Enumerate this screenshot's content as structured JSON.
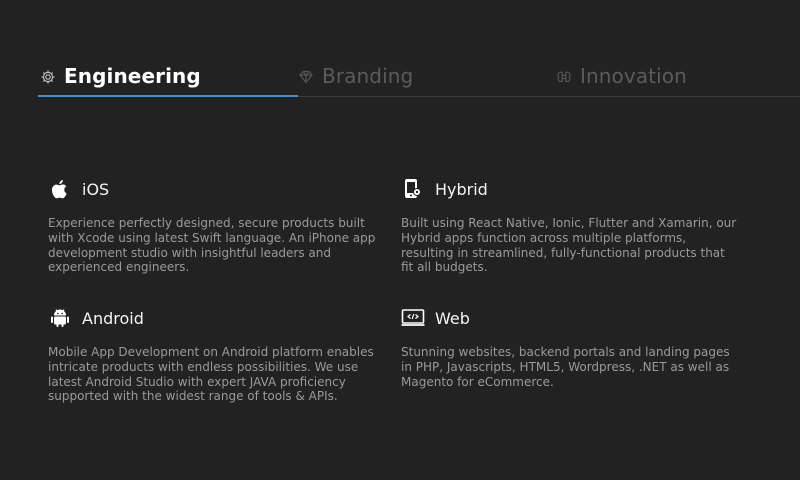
{
  "tabs": [
    {
      "label": "Engineering",
      "icon": "gear-icon",
      "active": true
    },
    {
      "label": "Branding",
      "icon": "diamond-icon",
      "active": false
    },
    {
      "label": "Innovation",
      "icon": "brain-icon",
      "active": false
    }
  ],
  "services": {
    "ios": {
      "title": "iOS",
      "icon": "apple-icon",
      "desc": "Experience perfectly designed, secure products built with Xcode using latest Swift language. An iPhone app development studio with insightful leaders and experienced engineers."
    },
    "hybrid": {
      "title": "Hybrid",
      "icon": "hybrid-device-icon",
      "desc": "Built using React Native, Ionic, Flutter and Xamarin, our Hybrid apps function across multiple platforms, resulting in streamlined, fully-functional products that fit all budgets."
    },
    "android": {
      "title": "Android",
      "icon": "android-icon",
      "desc": "Mobile App Development on Android platform enables intricate products with endless possibilities. We use latest Android Studio with expert JAVA proficiency supported with the widest range of tools & APIs."
    },
    "web": {
      "title": "Web",
      "icon": "code-window-icon",
      "desc": "Stunning websites, backend portals and landing pages in PHP, Javascripts, HTML5, Wordpress, .NET as well as Magento for eCommerce."
    }
  },
  "colors": {
    "background": "#222222",
    "accent": "#3f8fd8",
    "active_tab_text": "#ffffff",
    "inactive_tab_text": "#5b5b5b",
    "body_text": "#9a9a9a"
  }
}
